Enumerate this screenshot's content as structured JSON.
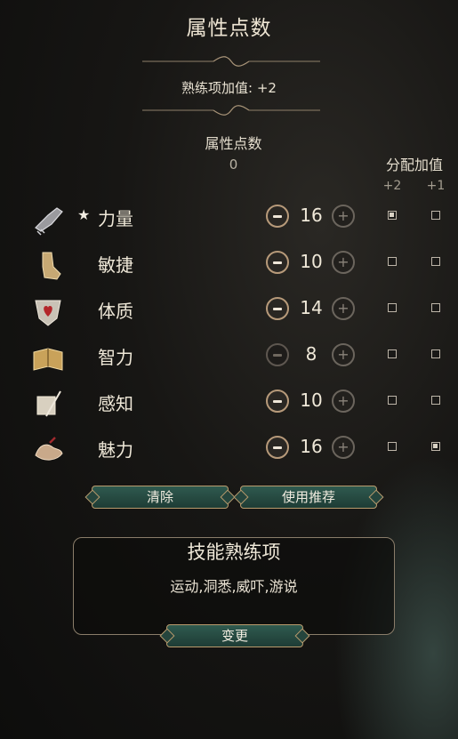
{
  "header": {
    "title": "属性点数"
  },
  "proficiency": {
    "label": "熟练项加值: +2"
  },
  "points": {
    "label": "属性点数",
    "value": "0"
  },
  "allocation": {
    "label": "分配加值",
    "col1": "+2",
    "col2": "+1"
  },
  "abilities": [
    {
      "name": "力量",
      "value": "16",
      "star": "★",
      "icon": "gauntlet-icon",
      "minus_enabled": true,
      "plus2": true,
      "plus1": false
    },
    {
      "name": "敏捷",
      "value": "10",
      "star": "",
      "icon": "boot-icon",
      "minus_enabled": true,
      "plus2": false,
      "plus1": false
    },
    {
      "name": "体质",
      "value": "14",
      "star": "",
      "icon": "heart-shield-icon",
      "minus_enabled": true,
      "plus2": false,
      "plus1": false
    },
    {
      "name": "智力",
      "value": "8",
      "star": "",
      "icon": "book-icon",
      "minus_enabled": false,
      "plus2": false,
      "plus1": false
    },
    {
      "name": "感知",
      "value": "10",
      "star": "",
      "icon": "scroll-quill-icon",
      "minus_enabled": true,
      "plus2": false,
      "plus1": false
    },
    {
      "name": "魅力",
      "value": "16",
      "star": "",
      "icon": "hands-icon",
      "minus_enabled": true,
      "plus2": false,
      "plus1": true
    }
  ],
  "actions": {
    "clear": "清除",
    "recommend": "使用推荐"
  },
  "skills": {
    "title": "技能熟练项",
    "list": "运动,洞悉,威吓,游说",
    "change": "变更"
  },
  "colors": {
    "accent_gold": "#b99b6d",
    "button_green": "#2f5a4f",
    "text": "#efe8d8"
  }
}
